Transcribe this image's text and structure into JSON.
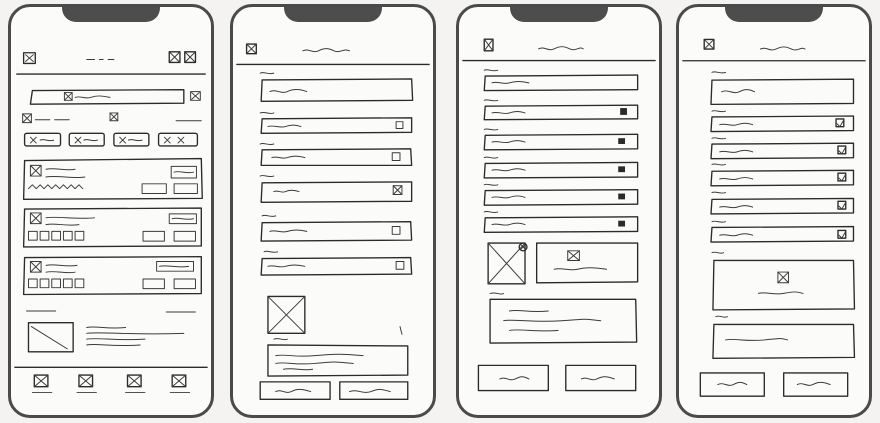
{
  "sketches": [
    {
      "screen": "home-feed"
    },
    {
      "screen": "form-with-fields"
    },
    {
      "screen": "form-with-image"
    },
    {
      "screen": "form-with-checkboxes"
    }
  ]
}
